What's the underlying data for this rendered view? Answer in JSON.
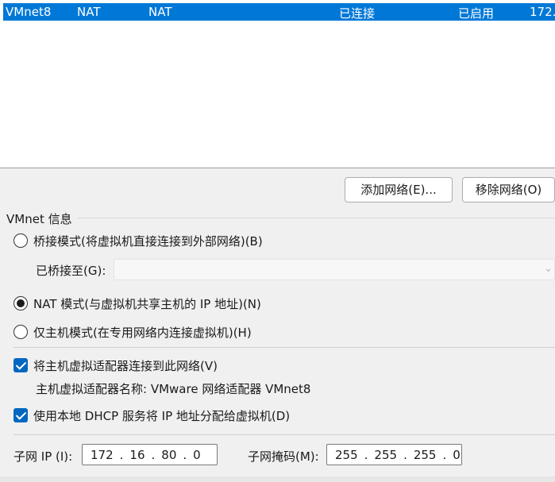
{
  "network_list": {
    "rows": [
      {
        "name": "VMnet8",
        "type": "NAT",
        "external": "NAT",
        "host_connection": "已连接",
        "dhcp": "已启用",
        "subnet": "172."
      }
    ]
  },
  "buttons": {
    "add_network": "添加网络(E)...",
    "remove_network": "移除网络(O)"
  },
  "vmnet_info": {
    "group_title": "VMnet 信息",
    "bridged_option": "桥接模式(将虚拟机直接连接到外部网络)(B)",
    "bridged_to_label": "已桥接至(G):",
    "bridged_to_value": "",
    "nat_option": "NAT 模式(与虚拟机共享主机的 IP 地址)(N)",
    "host_only_option": "仅主机模式(在专用网络内连接虚拟机)(H)",
    "connect_adapter": "将主机虚拟适配器连接到此网络(V)",
    "adapter_name": "主机虚拟适配器名称: VMware 网络适配器 VMnet8",
    "use_dhcp": "使用本地 DHCP 服务将 IP 地址分配给虚拟机(D)",
    "selected_mode": "nat"
  },
  "subnet": {
    "ip_label": "子网 IP (I):",
    "ip_octets": [
      "172",
      "16",
      "80",
      "0"
    ],
    "mask_label": "子网掩码(M):",
    "mask_octets": [
      "255",
      "255",
      "255",
      "0"
    ]
  },
  "colors": {
    "selection": "#0078d7",
    "checkbox": "#0067c0"
  }
}
